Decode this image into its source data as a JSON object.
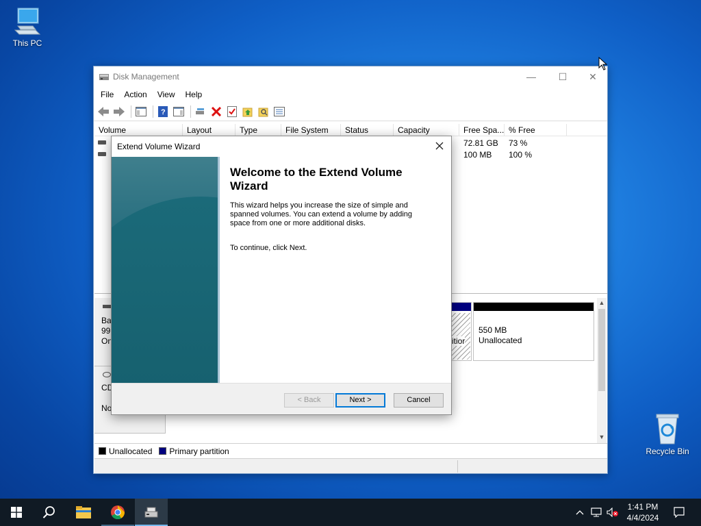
{
  "desktop": {
    "icons": [
      {
        "label": "This PC",
        "icon": "computer-icon"
      },
      {
        "label": "Recycle Bin",
        "icon": "recycle-bin-icon"
      }
    ]
  },
  "window": {
    "title": "Disk Management",
    "menu": [
      "File",
      "Action",
      "View",
      "Help"
    ],
    "controls": {
      "minimize": "—",
      "maximize": "☐",
      "close": "✕"
    }
  },
  "volume_list": {
    "columns": [
      "Volume",
      "Layout",
      "Type",
      "File System",
      "Status",
      "Capacity",
      "Free Spa...",
      "% Free"
    ],
    "rows": [
      {
        "free_space": "72.81 GB",
        "percent_free": "73 %"
      },
      {
        "free_space": "100 MB",
        "percent_free": "100 %"
      }
    ]
  },
  "graphical_view": {
    "disk0": {
      "label_line1": "Ba",
      "label_line2": "99.",
      "label_line3": "On"
    },
    "cdrom": {
      "label_line1": "CD",
      "label_line2": "No"
    },
    "partition_hidden_text": "itior",
    "unallocated": {
      "size": "550 MB",
      "label": "Unallocated"
    }
  },
  "legend": [
    {
      "label": "Unallocated",
      "color": "#000000"
    },
    {
      "label": "Primary partition",
      "color": "#00007f"
    }
  ],
  "wizard": {
    "title": "Extend Volume Wizard",
    "heading": "Welcome to the Extend Volume Wizard",
    "body": "This wizard helps you increase the size of simple and spanned volumes. You can extend a volume  by adding space from one or more additional disks.",
    "continue_text": "To continue, click Next.",
    "buttons": {
      "back": "< Back",
      "next": "Next >",
      "cancel": "Cancel"
    }
  },
  "taskbar": {
    "time": "1:41 PM",
    "date": "4/4/2024"
  },
  "colors": {
    "accent": "#0078d7",
    "primary_partition": "#00007f",
    "taskbar": "#101a24"
  }
}
